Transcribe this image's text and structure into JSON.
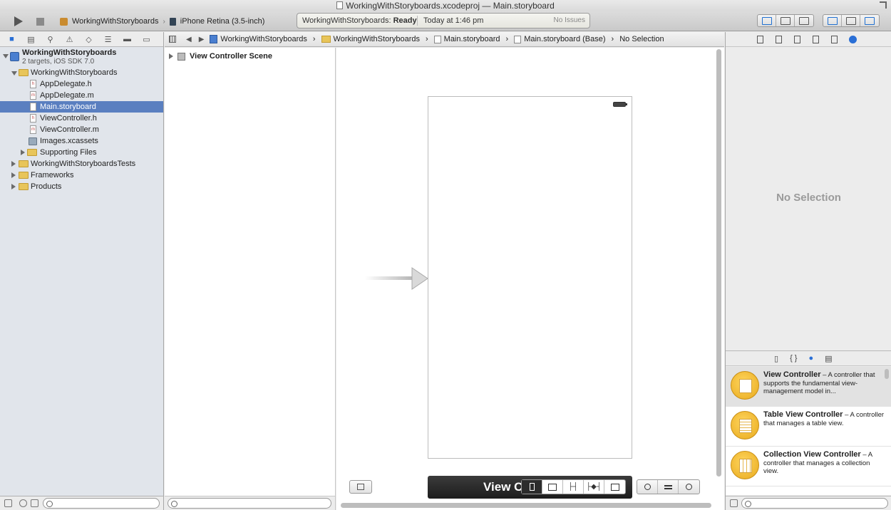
{
  "window": {
    "title": "WorkingWithStoryboards.xcodeproj — Main.storyboard"
  },
  "toolbar": {
    "scheme": "WorkingWithStoryboards",
    "destination": "iPhone Retina (3.5-inch)",
    "activity_project": "WorkingWithStoryboards:",
    "activity_status": "Ready",
    "activity_time": "Today at 1:46 pm",
    "activity_issues": "No Issues"
  },
  "navigator": {
    "project_name": "WorkingWithStoryboards",
    "project_sub": "2 targets, iOS SDK 7.0",
    "items": [
      {
        "label": "WorkingWithStoryboards"
      },
      {
        "label": "AppDelegate.h",
        "ext": "h"
      },
      {
        "label": "AppDelegate.m",
        "ext": "m"
      },
      {
        "label": "Main.storyboard",
        "ext": "sb"
      },
      {
        "label": "ViewController.h",
        "ext": "h"
      },
      {
        "label": "ViewController.m",
        "ext": "m"
      },
      {
        "label": "Images.xcassets"
      },
      {
        "label": "Supporting Files"
      },
      {
        "label": "WorkingWithStoryboardsTests"
      },
      {
        "label": "Frameworks"
      },
      {
        "label": "Products"
      }
    ]
  },
  "jumpbar": {
    "crumbs": [
      "WorkingWithStoryboards",
      "WorkingWithStoryboards",
      "Main.storyboard",
      "Main.storyboard (Base)",
      "No Selection"
    ]
  },
  "outline": {
    "scene": "View Controller Scene"
  },
  "canvas": {
    "dock_label": "View C"
  },
  "inspector": {
    "empty_text": "No Selection"
  },
  "library": {
    "tabs": [
      "file-template-icon",
      "code-snippet-icon",
      "object-icon",
      "media-icon"
    ],
    "items": [
      {
        "name": "View Controller",
        "desc": " – A controller that supports the fundamental view-management model in..."
      },
      {
        "name": "Table View Controller",
        "desc": " – A controller that manages a table view."
      },
      {
        "name": "Collection View Controller",
        "desc": " – A controller that manages a collection view."
      }
    ]
  },
  "colors": {
    "selection": "#5a7fc0",
    "accent": "#2a6fd6",
    "library_icon": "#f0bd33"
  }
}
